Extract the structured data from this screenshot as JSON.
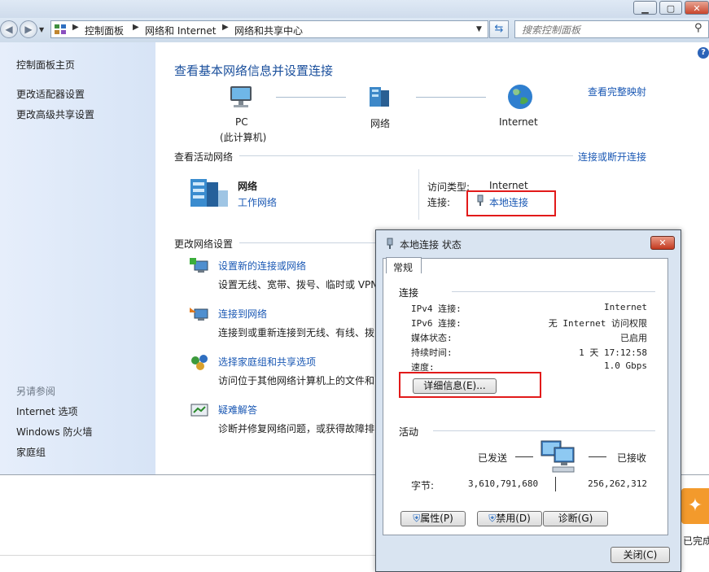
{
  "window": {
    "minimize_glyph": "▁",
    "maximize_glyph": "▢",
    "close_glyph": "✕"
  },
  "address": {
    "breadcrumbs": [
      "控制面板",
      "网络和 Internet",
      "网络和共享中心"
    ],
    "search_placeholder": "搜索控制面板"
  },
  "sidebar": {
    "items": [
      "控制面板主页",
      "更改适配器设置",
      "更改高级共享设置"
    ],
    "see_also_label": "另请参阅",
    "see_also": [
      "Internet 选项",
      "Windows 防火墙",
      "家庭组"
    ]
  },
  "main": {
    "title": "查看基本网络信息并设置连接",
    "full_map_link": "查看完整映射",
    "map": {
      "pc_label": "PC",
      "pc_sublabel": "(此计算机)",
      "network_label": "网络",
      "internet_label": "Internet"
    },
    "active_header": "查看活动网络",
    "connect_disconnect_link": "连接或断开连接",
    "active": {
      "name": "网络",
      "type_link": "工作网络",
      "access_type_label": "访问类型:",
      "access_type_value": "Internet",
      "connection_label": "连接:",
      "connection_link": "本地连接"
    },
    "change_header": "更改网络设置",
    "tasks": [
      {
        "title": "设置新的连接或网络",
        "desc": "设置无线、宽带、拨号、临时或 VPN"
      },
      {
        "title": "连接到网络",
        "desc": "连接到或重新连接到无线、有线、拨"
      },
      {
        "title": "选择家庭组和共享选项",
        "desc": "访问位于其他网络计算机上的文件和"
      },
      {
        "title": "疑难解答",
        "desc": "诊断并修复网络问题，或获得故障排"
      }
    ]
  },
  "dialog": {
    "title": "本地连接 状态",
    "tab": "常规",
    "connection_section": "连接",
    "rows": [
      {
        "label": "IPv4 连接:",
        "value": "Internet"
      },
      {
        "label": "IPv6 连接:",
        "value": "无 Internet 访问权限"
      },
      {
        "label": "媒体状态:",
        "value": "已启用"
      },
      {
        "label": "持续时间:",
        "value": "1 天 17:12:58"
      },
      {
        "label": "速度:",
        "value": "1.0 Gbps"
      }
    ],
    "details_button": "详细信息(E)...",
    "activity_section": "活动",
    "sent_label": "已发送",
    "received_label": "已接收",
    "bytes_label": "字节:",
    "bytes_sent": "3,610,791,680",
    "bytes_received": "256,262,312",
    "properties_button": "属性(P)",
    "disable_button": "禁用(D)",
    "diagnose_button": "诊断(G)",
    "close_button": "关闭(C)"
  },
  "background": {
    "partial_text": "已完成"
  },
  "colors": {
    "link": "#1a58b4",
    "highlight_box": "#e21a1a",
    "sidebar_bg": "#dbe6f7",
    "dialog_frame": "#d9e4f1"
  }
}
